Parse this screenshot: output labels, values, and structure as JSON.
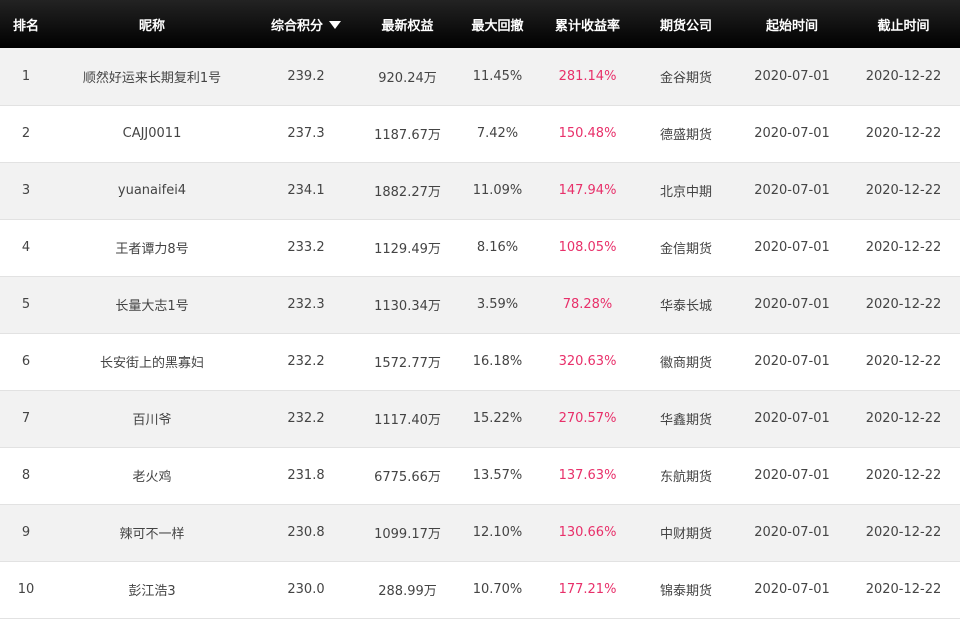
{
  "headers": {
    "rank": "排名",
    "nickname": "昵称",
    "score": "综合积分",
    "equity": "最新权益",
    "drawdown": "最大回撤",
    "return": "累计收益率",
    "company": "期货公司",
    "start": "起始时间",
    "end": "截止时间"
  },
  "sort_icon": "sort-desc-triangle-icon",
  "colors": {
    "header_bg": "#111111",
    "return_text": "#e8306a",
    "stripe": "#f2f2f2"
  },
  "rows": [
    {
      "rank": "1",
      "nickname": "顺然好运来长期复利1号",
      "score": "239.2",
      "equity": "920.24万",
      "drawdown": "11.45%",
      "return": "281.14%",
      "company": "金谷期货",
      "start": "2020-07-01",
      "end": "2020-12-22"
    },
    {
      "rank": "2",
      "nickname": "CAJJ0011",
      "score": "237.3",
      "equity": "1187.67万",
      "drawdown": "7.42%",
      "return": "150.48%",
      "company": "德盛期货",
      "start": "2020-07-01",
      "end": "2020-12-22"
    },
    {
      "rank": "3",
      "nickname": "yuanaifei4",
      "score": "234.1",
      "equity": "1882.27万",
      "drawdown": "11.09%",
      "return": "147.94%",
      "company": "北京中期",
      "start": "2020-07-01",
      "end": "2020-12-22"
    },
    {
      "rank": "4",
      "nickname": "王者谭力8号",
      "score": "233.2",
      "equity": "1129.49万",
      "drawdown": "8.16%",
      "return": "108.05%",
      "company": "金信期货",
      "start": "2020-07-01",
      "end": "2020-12-22"
    },
    {
      "rank": "5",
      "nickname": "长量大志1号",
      "score": "232.3",
      "equity": "1130.34万",
      "drawdown": "3.59%",
      "return": "78.28%",
      "company": "华泰长城",
      "start": "2020-07-01",
      "end": "2020-12-22"
    },
    {
      "rank": "6",
      "nickname": "长安街上的黑寡妇",
      "score": "232.2",
      "equity": "1572.77万",
      "drawdown": "16.18%",
      "return": "320.63%",
      "company": "徽商期货",
      "start": "2020-07-01",
      "end": "2020-12-22"
    },
    {
      "rank": "7",
      "nickname": "百川爷",
      "score": "232.2",
      "equity": "1117.40万",
      "drawdown": "15.22%",
      "return": "270.57%",
      "company": "华鑫期货",
      "start": "2020-07-01",
      "end": "2020-12-22"
    },
    {
      "rank": "8",
      "nickname": "老火鸡",
      "score": "231.8",
      "equity": "6775.66万",
      "drawdown": "13.57%",
      "return": "137.63%",
      "company": "东航期货",
      "start": "2020-07-01",
      "end": "2020-12-22"
    },
    {
      "rank": "9",
      "nickname": "辣可不一样",
      "score": "230.8",
      "equity": "1099.17万",
      "drawdown": "12.10%",
      "return": "130.66%",
      "company": "中财期货",
      "start": "2020-07-01",
      "end": "2020-12-22"
    },
    {
      "rank": "10",
      "nickname": "彭江浩3",
      "score": "230.0",
      "equity": "288.99万",
      "drawdown": "10.70%",
      "return": "177.21%",
      "company": "锦泰期货",
      "start": "2020-07-01",
      "end": "2020-12-22"
    }
  ]
}
